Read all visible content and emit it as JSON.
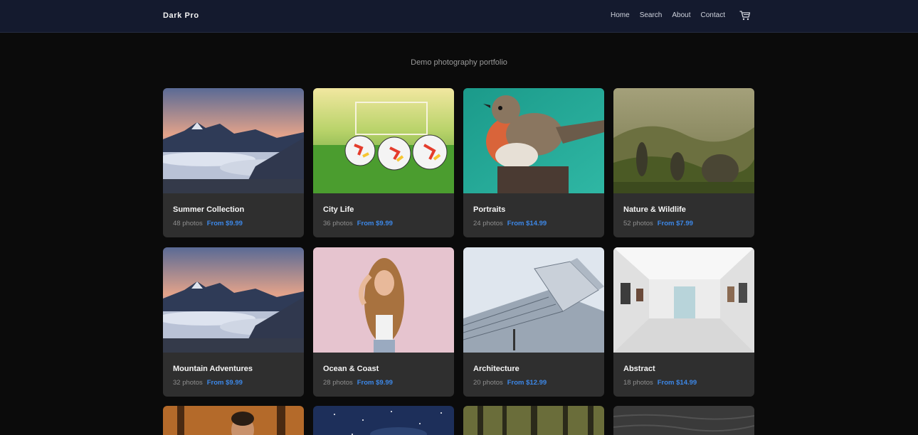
{
  "header": {
    "brand": "Dark Pro",
    "nav": [
      "Home",
      "Search",
      "About",
      "Contact"
    ],
    "cart_icon": "cart-icon"
  },
  "tagline": "Demo photography portfolio",
  "cards": [
    {
      "title": "Summer Collection",
      "photos": "48 photos",
      "price": "From $9.99",
      "image": "mountain-sunset-clouds"
    },
    {
      "title": "City Life",
      "photos": "36 photos",
      "price": "From $9.99",
      "image": "soccer-balls-grass"
    },
    {
      "title": "Portraits",
      "photos": "24 photos",
      "price": "From $14.99",
      "image": "robin-bird"
    },
    {
      "title": "Nature & Wildlife",
      "photos": "52 photos",
      "price": "From $7.99",
      "image": "misty-green-valley"
    },
    {
      "title": "Mountain Adventures",
      "photos": "32 photos",
      "price": "From $9.99",
      "image": "mountain-sunset-clouds"
    },
    {
      "title": "Ocean & Coast",
      "photos": "28 photos",
      "price": "From $9.99",
      "image": "woman-pink-backdrop"
    },
    {
      "title": "Architecture",
      "photos": "20 photos",
      "price": "From $12.99",
      "image": "modern-building"
    },
    {
      "title": "Abstract",
      "photos": "18 photos",
      "price": "From $14.99",
      "image": "white-gallery"
    }
  ],
  "partial_cards": [
    "man-autumn-forest",
    "starry-night-sky",
    "forest-trees",
    "dark-water"
  ],
  "colors": {
    "header_bg": "#141a2e",
    "page_bg": "#0b0b0b",
    "card_bg": "#2f2f2f",
    "price": "#3d88e8"
  }
}
